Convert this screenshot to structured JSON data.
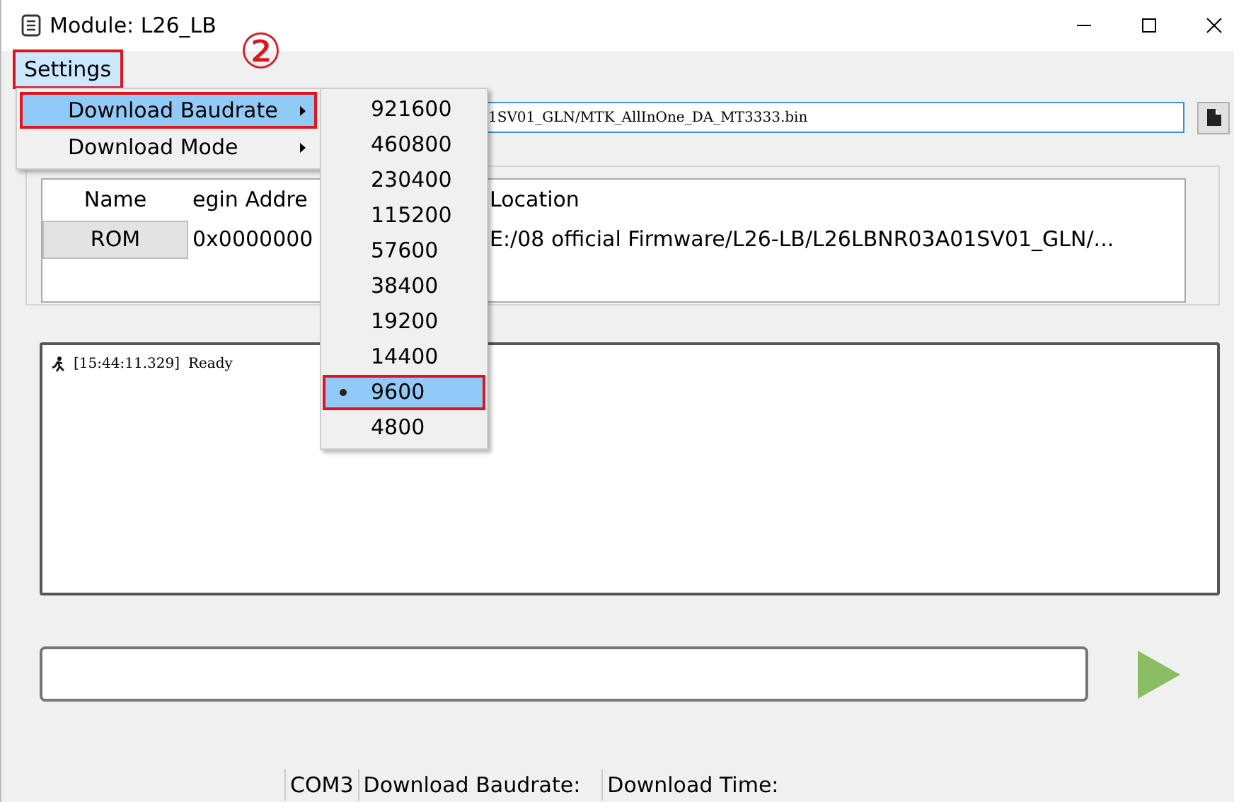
{
  "window": {
    "title": "Module: L26_LB"
  },
  "menu_bar": [
    {
      "label": "Settings",
      "selected": true,
      "outlined": true
    }
  ],
  "annotation": "②",
  "settings_menu": [
    {
      "label": "Download Baudrate",
      "selected": true,
      "outlined": true,
      "submenu": true
    },
    {
      "label": "Download Mode",
      "selected": false,
      "outlined": false,
      "submenu": true
    }
  ],
  "baudrate_menu": [
    {
      "label": "921600",
      "selected": false,
      "outlined": false
    },
    {
      "label": "460800",
      "selected": false,
      "outlined": false
    },
    {
      "label": "230400",
      "selected": false,
      "outlined": false
    },
    {
      "label": "115200",
      "selected": false,
      "outlined": false
    },
    {
      "label": "57600",
      "selected": false,
      "outlined": false
    },
    {
      "label": "38400",
      "selected": false,
      "outlined": false
    },
    {
      "label": "19200",
      "selected": false,
      "outlined": false
    },
    {
      "label": "14400",
      "selected": false,
      "outlined": false
    },
    {
      "label": "9600",
      "selected": true,
      "outlined": true
    },
    {
      "label": "4800",
      "selected": false,
      "outlined": false
    }
  ],
  "da_file": {
    "value": "1SV01_GLN/MTK_AllInOne_DA_MT3333.bin"
  },
  "table": {
    "columns": [
      "Name",
      "egin Addre",
      "Location"
    ],
    "rows": [
      [
        "ROM",
        "0x0000000",
        "E:/08  official Firmware/L26-LB/L26LBNR03A01SV01_GLN/..."
      ]
    ]
  },
  "log": [
    {
      "time": "[15:44:11.329]",
      "message": "Ready"
    }
  ],
  "status_bar": [
    "COM3",
    "Download Baudrate:",
    "Download Time:"
  ]
}
